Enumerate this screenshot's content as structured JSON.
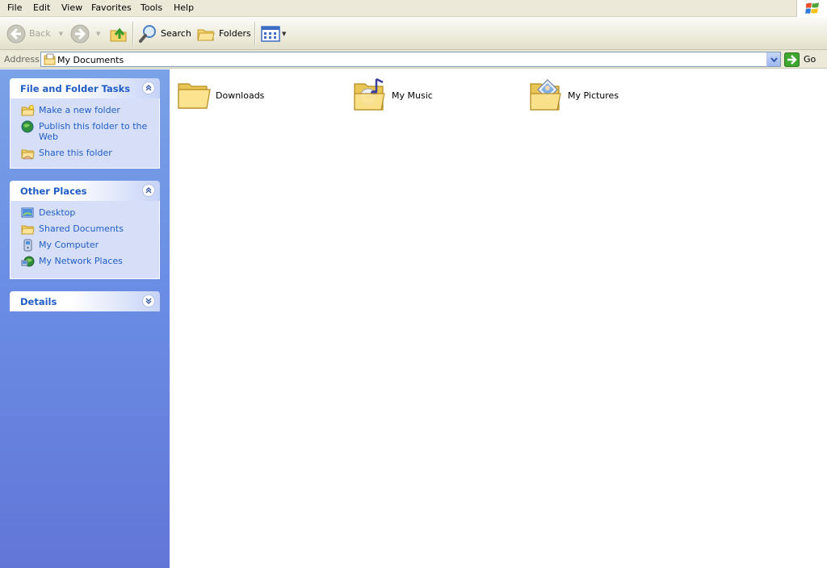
{
  "menu": [
    "File",
    "Edit",
    "View",
    "Favorites",
    "Tools",
    "Help"
  ],
  "toolbar": {
    "back_label": "Back",
    "search_label": "Search",
    "folders_label": "Folders"
  },
  "address": {
    "label": "Address",
    "value": "My Documents",
    "go_label": "Go"
  },
  "taskpane": {
    "file_tasks": {
      "title": "File and Folder Tasks",
      "items": [
        "Make a new folder",
        "Publish this folder to the Web",
        "Share this folder"
      ]
    },
    "other_places": {
      "title": "Other Places",
      "items": [
        "Desktop",
        "Shared Documents",
        "My Computer",
        "My Network Places"
      ]
    },
    "details": {
      "title": "Details"
    }
  },
  "folders": [
    {
      "label": "Downloads",
      "icon": "folder-icon"
    },
    {
      "label": "My Music",
      "icon": "music-folder-icon"
    },
    {
      "label": "My Pictures",
      "icon": "pictures-folder-icon"
    }
  ],
  "colors": {
    "taskpane_top": "#7ba2e7",
    "taskpane_bottom": "#6276d8",
    "link": "#215dc6",
    "chrome": "#ece9d8"
  }
}
